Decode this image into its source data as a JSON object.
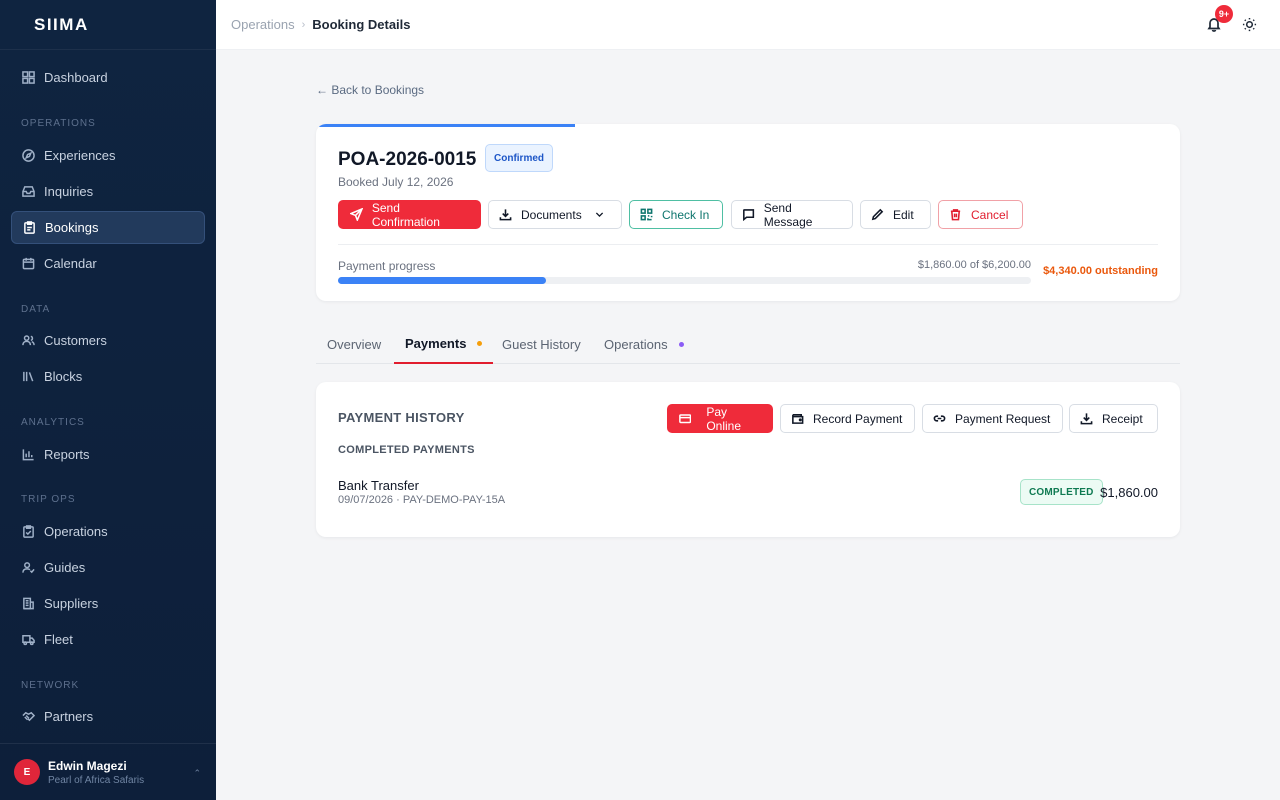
{
  "app": {
    "logo": "SIIMA"
  },
  "sidebar": {
    "items": [
      {
        "label": "Dashboard",
        "icon": "grid-icon"
      },
      {
        "label": "Experiences",
        "icon": "compass-icon"
      },
      {
        "label": "Inquiries",
        "icon": "inbox-icon"
      },
      {
        "label": "Bookings",
        "icon": "clipboard-icon",
        "active": true
      },
      {
        "label": "Calendar",
        "icon": "calendar-icon"
      },
      {
        "label": "Customers",
        "icon": "users-icon"
      },
      {
        "label": "Blocks",
        "icon": "library-icon"
      },
      {
        "label": "Reports",
        "icon": "bar-chart-icon"
      },
      {
        "label": "Operations",
        "icon": "clipboard-check-icon"
      },
      {
        "label": "Guides",
        "icon": "user-check-icon"
      },
      {
        "label": "Suppliers",
        "icon": "building-icon"
      },
      {
        "label": "Fleet",
        "icon": "truck-icon"
      },
      {
        "label": "Partners",
        "icon": "handshake-icon"
      }
    ],
    "sections": [
      "OPERATIONS",
      "DATA",
      "ANALYTICS",
      "TRIP OPS",
      "NETWORK"
    ],
    "user": {
      "initial": "E",
      "name": "Edwin Magezi",
      "org": "Pearl of Africa Safaris"
    }
  },
  "topbar": {
    "breadcrumb": [
      "Operations",
      "Booking Details"
    ],
    "notification_count": "9+"
  },
  "back_link": "← Back to Bookings",
  "booking": {
    "id": "POA-2026-0015",
    "status": "Confirmed",
    "booked_date": "Booked July 12, 2026",
    "actions": {
      "send_confirmation": "Send Confirmation",
      "documents": "Documents",
      "check_in": "Check In",
      "send_message": "Send Message",
      "edit": "Edit",
      "cancel": "Cancel"
    },
    "payment_progress": {
      "label": "Payment progress",
      "amount_text": "$1,860.00 of $6,200.00",
      "paid": 1860,
      "total": 6200,
      "fraction": 0.3,
      "outstanding": "$4,340.00 outstanding"
    }
  },
  "tabs": [
    {
      "label": "Overview",
      "active": false
    },
    {
      "label": "Payments",
      "active": true,
      "dot_color": "#f59e0b"
    },
    {
      "label": "Guest History",
      "active": false
    },
    {
      "label": "Operations",
      "active": false,
      "dot_color": "#8b5cf6"
    }
  ],
  "payments": {
    "title": "PAYMENT HISTORY",
    "actions": {
      "pay_online": "Pay Online",
      "record_payment": "Record Payment",
      "payment_request": "Payment Request",
      "receipt": "Receipt"
    },
    "completed_title": "COMPLETED PAYMENTS",
    "items": [
      {
        "method": "Bank Transfer",
        "reference": "09/07/2026 · PAY-DEMO-PAY-15A",
        "status": "COMPLETED",
        "amount": "$1,860.00"
      }
    ]
  },
  "colors": {
    "accent_red": "#ef2b3a",
    "progress_blue": "#3b82f6",
    "outstanding_orange": "#ea580c",
    "sidebar_bg": "#0f2440"
  }
}
